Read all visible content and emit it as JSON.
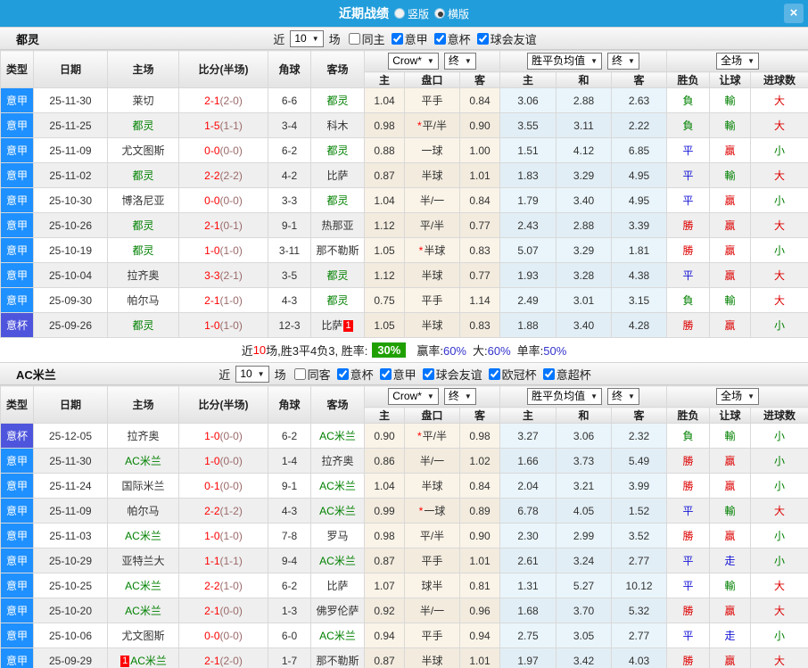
{
  "title_bar": {
    "title": "近期战绩",
    "layout_options": [
      {
        "label": "竖版",
        "selected": false
      },
      {
        "label": "横版",
        "selected": true
      }
    ],
    "close_icon": "×"
  },
  "filter_labels": {
    "prefix": "近",
    "suffix": "场"
  },
  "columns": {
    "left": [
      "类型",
      "日期",
      "主场",
      "比分(半场)",
      "角球",
      "客场"
    ],
    "group1": {
      "selects": [
        "Crow*",
        "终"
      ],
      "subcols": [
        "主",
        "盘口",
        "客"
      ]
    },
    "group2": {
      "selects": [
        "胜平负均值",
        "终"
      ],
      "subcols": [
        "主",
        "和",
        "客"
      ]
    },
    "group3": {
      "selects": [
        "全场"
      ],
      "subcols": [
        "胜负",
        "让球",
        "进球数"
      ]
    }
  },
  "colors": {
    "league_type": {
      "意甲": "#1e90ff",
      "意杯": "#4e55dc"
    },
    "result_chars": {
      "勝": "#dd0000",
      "負": "#008000",
      "平": "#1515d6",
      "贏": "#dd0000",
      "輸": "#008000",
      "走": "#1515d6",
      "大": "#dd0000",
      "小": "#008000"
    },
    "team_highlight": "#008000",
    "badge_bg": "#ff0000",
    "rate_badge_bg": "#1fa000",
    "summary_value": "#3333cc"
  },
  "sections": [
    {
      "team": "都灵",
      "match_count": "10",
      "checkboxes": [
        {
          "label": "同主",
          "checked": false
        },
        {
          "label": "意甲",
          "checked": true
        },
        {
          "label": "意杯",
          "checked": true
        },
        {
          "label": "球会友谊",
          "checked": true
        }
      ],
      "rows": [
        {
          "league": "意甲",
          "date": "25-11-30",
          "home": "莱切",
          "home_badge": "",
          "score": "2-1",
          "half": "(2-0)",
          "corners": "6-6",
          "away": "都灵",
          "away_badge": "",
          "home_odds": "1.04",
          "handicap": "平手",
          "star": false,
          "away_odds": "0.84",
          "avg_win": "3.06",
          "avg_draw": "2.88",
          "avg_lose": "2.63",
          "outcome": "負",
          "handicap_outcome": "輸",
          "goals_outcome": "大"
        },
        {
          "league": "意甲",
          "date": "25-11-25",
          "home": "都灵",
          "home_badge": "",
          "score": "1-5",
          "half": "(1-1)",
          "corners": "3-4",
          "away": "科木",
          "away_badge": "",
          "home_odds": "0.98",
          "handicap": "平/半",
          "star": true,
          "away_odds": "0.90",
          "avg_win": "3.55",
          "avg_draw": "3.11",
          "avg_lose": "2.22",
          "outcome": "負",
          "handicap_outcome": "輸",
          "goals_outcome": "大"
        },
        {
          "league": "意甲",
          "date": "25-11-09",
          "home": "尤文图斯",
          "home_badge": "",
          "score": "0-0",
          "half": "(0-0)",
          "corners": "6-2",
          "away": "都灵",
          "away_badge": "",
          "home_odds": "0.88",
          "handicap": "一球",
          "star": false,
          "away_odds": "1.00",
          "avg_win": "1.51",
          "avg_draw": "4.12",
          "avg_lose": "6.85",
          "outcome": "平",
          "handicap_outcome": "贏",
          "goals_outcome": "小"
        },
        {
          "league": "意甲",
          "date": "25-11-02",
          "home": "都灵",
          "home_badge": "",
          "score": "2-2",
          "half": "(2-2)",
          "corners": "4-2",
          "away": "比萨",
          "away_badge": "",
          "home_odds": "0.87",
          "handicap": "半球",
          "star": false,
          "away_odds": "1.01",
          "avg_win": "1.83",
          "avg_draw": "3.29",
          "avg_lose": "4.95",
          "outcome": "平",
          "handicap_outcome": "輸",
          "goals_outcome": "大"
        },
        {
          "league": "意甲",
          "date": "25-10-30",
          "home": "博洛尼亚",
          "home_badge": "",
          "score": "0-0",
          "half": "(0-0)",
          "corners": "3-3",
          "away": "都灵",
          "away_badge": "",
          "home_odds": "1.04",
          "handicap": "半/一",
          "star": false,
          "away_odds": "0.84",
          "avg_win": "1.79",
          "avg_draw": "3.40",
          "avg_lose": "4.95",
          "outcome": "平",
          "handicap_outcome": "贏",
          "goals_outcome": "小"
        },
        {
          "league": "意甲",
          "date": "25-10-26",
          "home": "都灵",
          "home_badge": "",
          "score": "2-1",
          "half": "(0-1)",
          "corners": "9-1",
          "away": "热那亚",
          "away_badge": "",
          "home_odds": "1.12",
          "handicap": "平/半",
          "star": false,
          "away_odds": "0.77",
          "avg_win": "2.43",
          "avg_draw": "2.88",
          "avg_lose": "3.39",
          "outcome": "勝",
          "handicap_outcome": "贏",
          "goals_outcome": "大"
        },
        {
          "league": "意甲",
          "date": "25-10-19",
          "home": "都灵",
          "home_badge": "",
          "score": "1-0",
          "half": "(1-0)",
          "corners": "3-11",
          "away": "那不勒斯",
          "away_badge": "",
          "home_odds": "1.05",
          "handicap": "半球",
          "star": true,
          "away_odds": "0.83",
          "avg_win": "5.07",
          "avg_draw": "3.29",
          "avg_lose": "1.81",
          "outcome": "勝",
          "handicap_outcome": "贏",
          "goals_outcome": "小"
        },
        {
          "league": "意甲",
          "date": "25-10-04",
          "home": "拉齐奥",
          "home_badge": "",
          "score": "3-3",
          "half": "(2-1)",
          "corners": "3-5",
          "away": "都灵",
          "away_badge": "",
          "home_odds": "1.12",
          "handicap": "半球",
          "star": false,
          "away_odds": "0.77",
          "avg_win": "1.93",
          "avg_draw": "3.28",
          "avg_lose": "4.38",
          "outcome": "平",
          "handicap_outcome": "贏",
          "goals_outcome": "大"
        },
        {
          "league": "意甲",
          "date": "25-09-30",
          "home": "帕尔马",
          "home_badge": "",
          "score": "2-1",
          "half": "(1-0)",
          "corners": "4-3",
          "away": "都灵",
          "away_badge": "",
          "home_odds": "0.75",
          "handicap": "平手",
          "star": false,
          "away_odds": "1.14",
          "avg_win": "2.49",
          "avg_draw": "3.01",
          "avg_lose": "3.15",
          "outcome": "負",
          "handicap_outcome": "輸",
          "goals_outcome": "大"
        },
        {
          "league": "意杯",
          "date": "25-09-26",
          "home": "都灵",
          "home_badge": "",
          "score": "1-0",
          "half": "(1-0)",
          "corners": "12-3",
          "away": "比萨",
          "away_badge": "1",
          "home_odds": "1.05",
          "handicap": "半球",
          "star": false,
          "away_odds": "0.83",
          "avg_win": "1.88",
          "avg_draw": "3.40",
          "avg_lose": "4.28",
          "outcome": "勝",
          "handicap_outcome": "贏",
          "goals_outcome": "小"
        }
      ],
      "summary": {
        "lead": [
          {
            "text": "近",
            "red": false
          },
          {
            "text": "10",
            "red": true
          },
          {
            "text": "场,胜3平4负3, 胜率:",
            "red": false
          }
        ],
        "rate_badge": "30%",
        "stats": [
          {
            "label": "赢率:",
            "value": "60%"
          },
          {
            "label": "大:",
            "value": "60%"
          },
          {
            "label": "单率:",
            "value": "50%"
          }
        ]
      }
    },
    {
      "team": "AC米兰",
      "match_count": "10",
      "checkboxes": [
        {
          "label": "同客",
          "checked": false
        },
        {
          "label": "意杯",
          "checked": true
        },
        {
          "label": "意甲",
          "checked": true
        },
        {
          "label": "球会友谊",
          "checked": true
        },
        {
          "label": "欧冠杯",
          "checked": true
        },
        {
          "label": "意超杯",
          "checked": true
        }
      ],
      "rows": [
        {
          "league": "意杯",
          "date": "25-12-05",
          "home": "拉齐奥",
          "home_badge": "",
          "score": "1-0",
          "half": "(0-0)",
          "corners": "6-2",
          "away": "AC米兰",
          "away_badge": "",
          "home_odds": "0.90",
          "handicap": "平/半",
          "star": true,
          "away_odds": "0.98",
          "avg_win": "3.27",
          "avg_draw": "3.06",
          "avg_lose": "2.32",
          "outcome": "負",
          "handicap_outcome": "輸",
          "goals_outcome": "小"
        },
        {
          "league": "意甲",
          "date": "25-11-30",
          "home": "AC米兰",
          "home_badge": "",
          "score": "1-0",
          "half": "(0-0)",
          "corners": "1-4",
          "away": "拉齐奥",
          "away_badge": "",
          "home_odds": "0.86",
          "handicap": "半/一",
          "star": false,
          "away_odds": "1.02",
          "avg_win": "1.66",
          "avg_draw": "3.73",
          "avg_lose": "5.49",
          "outcome": "勝",
          "handicap_outcome": "贏",
          "goals_outcome": "小"
        },
        {
          "league": "意甲",
          "date": "25-11-24",
          "home": "国际米兰",
          "home_badge": "",
          "score": "0-1",
          "half": "(0-0)",
          "corners": "9-1",
          "away": "AC米兰",
          "away_badge": "",
          "home_odds": "1.04",
          "handicap": "半球",
          "star": false,
          "away_odds": "0.84",
          "avg_win": "2.04",
          "avg_draw": "3.21",
          "avg_lose": "3.99",
          "outcome": "勝",
          "handicap_outcome": "贏",
          "goals_outcome": "小"
        },
        {
          "league": "意甲",
          "date": "25-11-09",
          "home": "帕尔马",
          "home_badge": "",
          "score": "2-2",
          "half": "(1-2)",
          "corners": "4-3",
          "away": "AC米兰",
          "away_badge": "",
          "home_odds": "0.99",
          "handicap": "一球",
          "star": true,
          "away_odds": "0.89",
          "avg_win": "6.78",
          "avg_draw": "4.05",
          "avg_lose": "1.52",
          "outcome": "平",
          "handicap_outcome": "輸",
          "goals_outcome": "大"
        },
        {
          "league": "意甲",
          "date": "25-11-03",
          "home": "AC米兰",
          "home_badge": "",
          "score": "1-0",
          "half": "(1-0)",
          "corners": "7-8",
          "away": "罗马",
          "away_badge": "",
          "home_odds": "0.98",
          "handicap": "平/半",
          "star": false,
          "away_odds": "0.90",
          "avg_win": "2.30",
          "avg_draw": "2.99",
          "avg_lose": "3.52",
          "outcome": "勝",
          "handicap_outcome": "贏",
          "goals_outcome": "小"
        },
        {
          "league": "意甲",
          "date": "25-10-29",
          "home": "亚特兰大",
          "home_badge": "",
          "score": "1-1",
          "half": "(1-1)",
          "corners": "9-4",
          "away": "AC米兰",
          "away_badge": "",
          "home_odds": "0.87",
          "handicap": "平手",
          "star": false,
          "away_odds": "1.01",
          "avg_win": "2.61",
          "avg_draw": "3.24",
          "avg_lose": "2.77",
          "outcome": "平",
          "handicap_outcome": "走",
          "goals_outcome": "小"
        },
        {
          "league": "意甲",
          "date": "25-10-25",
          "home": "AC米兰",
          "home_badge": "",
          "score": "2-2",
          "half": "(1-0)",
          "corners": "6-2",
          "away": "比萨",
          "away_badge": "",
          "home_odds": "1.07",
          "handicap": "球半",
          "star": false,
          "away_odds": "0.81",
          "avg_win": "1.31",
          "avg_draw": "5.27",
          "avg_lose": "10.12",
          "outcome": "平",
          "handicap_outcome": "輸",
          "goals_outcome": "大"
        },
        {
          "league": "意甲",
          "date": "25-10-20",
          "home": "AC米兰",
          "home_badge": "",
          "score": "2-1",
          "half": "(0-0)",
          "corners": "1-3",
          "away": "佛罗伦萨",
          "away_badge": "",
          "home_odds": "0.92",
          "handicap": "半/一",
          "star": false,
          "away_odds": "0.96",
          "avg_win": "1.68",
          "avg_draw": "3.70",
          "avg_lose": "5.32",
          "outcome": "勝",
          "handicap_outcome": "贏",
          "goals_outcome": "大"
        },
        {
          "league": "意甲",
          "date": "25-10-06",
          "home": "尤文图斯",
          "home_badge": "",
          "score": "0-0",
          "half": "(0-0)",
          "corners": "6-0",
          "away": "AC米兰",
          "away_badge": "",
          "home_odds": "0.94",
          "handicap": "平手",
          "star": false,
          "away_odds": "0.94",
          "avg_win": "2.75",
          "avg_draw": "3.05",
          "avg_lose": "2.77",
          "outcome": "平",
          "handicap_outcome": "走",
          "goals_outcome": "小"
        },
        {
          "league": "意甲",
          "date": "25-09-29",
          "home": "AC米兰",
          "home_badge": "1",
          "score": "2-1",
          "half": "(2-0)",
          "corners": "1-7",
          "away": "那不勒斯",
          "away_badge": "",
          "home_odds": "0.87",
          "handicap": "半球",
          "star": false,
          "away_odds": "1.01",
          "avg_win": "1.97",
          "avg_draw": "3.42",
          "avg_lose": "4.03",
          "outcome": "勝",
          "handicap_outcome": "贏",
          "goals_outcome": "大"
        }
      ]
    }
  ]
}
